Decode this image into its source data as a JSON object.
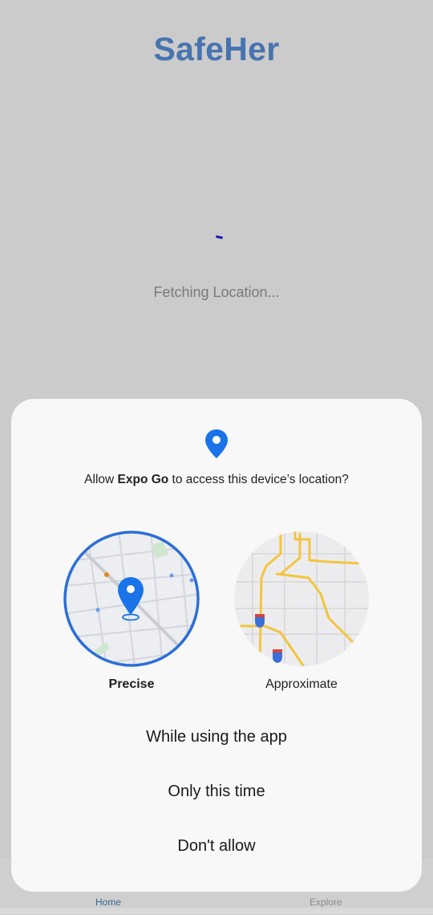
{
  "app": {
    "title": "SafeHer",
    "status": "Fetching Location..."
  },
  "tabs": [
    {
      "label": "Home",
      "active": true
    },
    {
      "label": "Explore",
      "active": false
    }
  ],
  "dialog": {
    "icon": "location-pin-icon",
    "message_prefix": "Allow ",
    "app_name": "Expo Go",
    "message_suffix": " to access this device’s location?",
    "options": [
      {
        "label": "Precise",
        "selected": true
      },
      {
        "label": "Approximate",
        "selected": false
      }
    ],
    "buttons": {
      "while_using": "While using the app",
      "only_this_time": "Only this time",
      "dont_allow": "Don't allow"
    }
  },
  "colors": {
    "brand": "#4774b0",
    "pin": "#1a73e8",
    "road": "#f2c53d"
  }
}
